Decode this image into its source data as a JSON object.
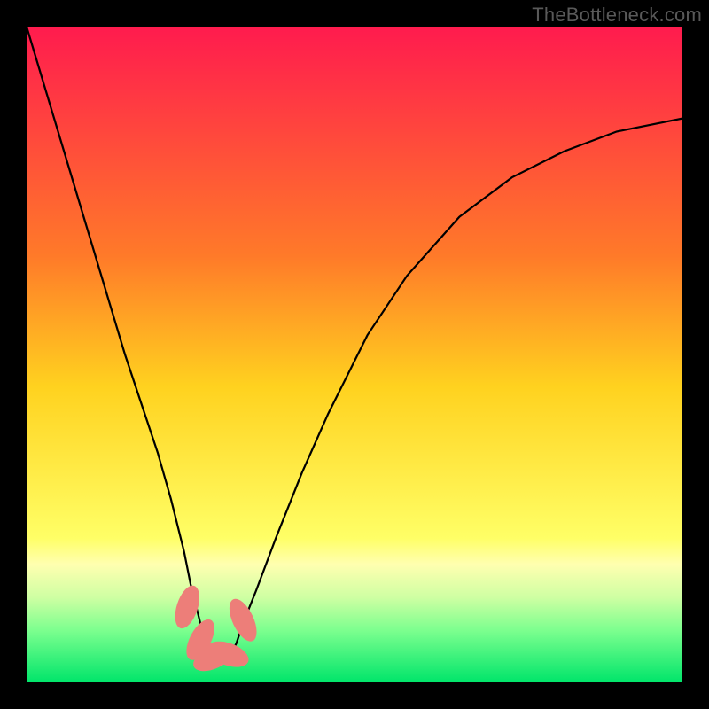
{
  "watermark": "TheBottleneck.com",
  "chart_data": {
    "type": "line",
    "title": "",
    "xlabel": "",
    "ylabel": "",
    "xlim": [
      0,
      100
    ],
    "ylim": [
      0,
      100
    ],
    "green_band_top_y": 15,
    "gradient_stops": [
      {
        "offset": 0,
        "color": "#ff1b4e"
      },
      {
        "offset": 35,
        "color": "#ff7a29"
      },
      {
        "offset": 55,
        "color": "#ffd21f"
      },
      {
        "offset": 78,
        "color": "#ffff66"
      },
      {
        "offset": 82,
        "color": "#ffffb0"
      },
      {
        "offset": 87,
        "color": "#cfffa3"
      },
      {
        "offset": 92,
        "color": "#7dff8f"
      },
      {
        "offset": 100,
        "color": "#00e56a"
      }
    ],
    "series": [
      {
        "name": "bottleneck-curve",
        "x": [
          0,
          3,
          6,
          9,
          12,
          15,
          18,
          20,
          22,
          24,
          25,
          26,
          27,
          28,
          29,
          30,
          31,
          32,
          33,
          35,
          38,
          42,
          46,
          52,
          58,
          66,
          74,
          82,
          90,
          100
        ],
        "y": [
          100,
          90,
          80,
          70,
          60,
          50,
          41,
          35,
          28,
          20,
          15,
          11,
          7,
          4,
          3,
          3,
          4,
          6,
          9,
          14,
          22,
          32,
          41,
          53,
          62,
          71,
          77,
          81,
          84,
          86
        ]
      }
    ],
    "markers": [
      {
        "x": 24.5,
        "y": 11.5,
        "rx": 1.6,
        "ry": 3.4,
        "rot": 18
      },
      {
        "x": 26.5,
        "y": 6.5,
        "rx": 1.6,
        "ry": 3.4,
        "rot": 28
      },
      {
        "x": 28.5,
        "y": 3.8,
        "rx": 1.7,
        "ry": 3.3,
        "rot": 65
      },
      {
        "x": 30.7,
        "y": 4.3,
        "rx": 1.7,
        "ry": 3.3,
        "rot": -70
      },
      {
        "x": 33.0,
        "y": 9.5,
        "rx": 1.6,
        "ry": 3.5,
        "rot": -25
      }
    ],
    "colors": {
      "curve": "#000000",
      "marker_fill": "#ed7e79",
      "background": "#000000"
    }
  }
}
